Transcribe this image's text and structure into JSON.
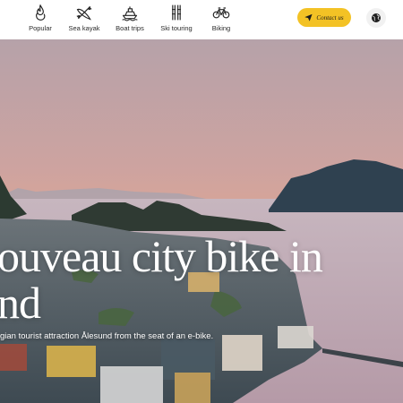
{
  "nav": {
    "items": [
      {
        "label": "Popular",
        "icon": "flame-icon"
      },
      {
        "label": "Sea kayak",
        "icon": "kayak-icon"
      },
      {
        "label": "Boat trips",
        "icon": "boat-icon"
      },
      {
        "label": "Ski touring",
        "icon": "ski-icon"
      },
      {
        "label": "Biking",
        "icon": "bicycle-icon"
      }
    ],
    "contact_label": "Contact us",
    "contact_icon": "send-icon",
    "language_icon": "globe-icon"
  },
  "hero": {
    "headline_line1": "ouveau city bike in",
    "headline_line2": "nd",
    "subtitle": "gian tourist attraction Ålesund from the seat of an e-bike."
  },
  "colors": {
    "accent": "#f3c225",
    "sky_top": "#b8a3a9",
    "sky_bottom": "#e4a88f"
  }
}
